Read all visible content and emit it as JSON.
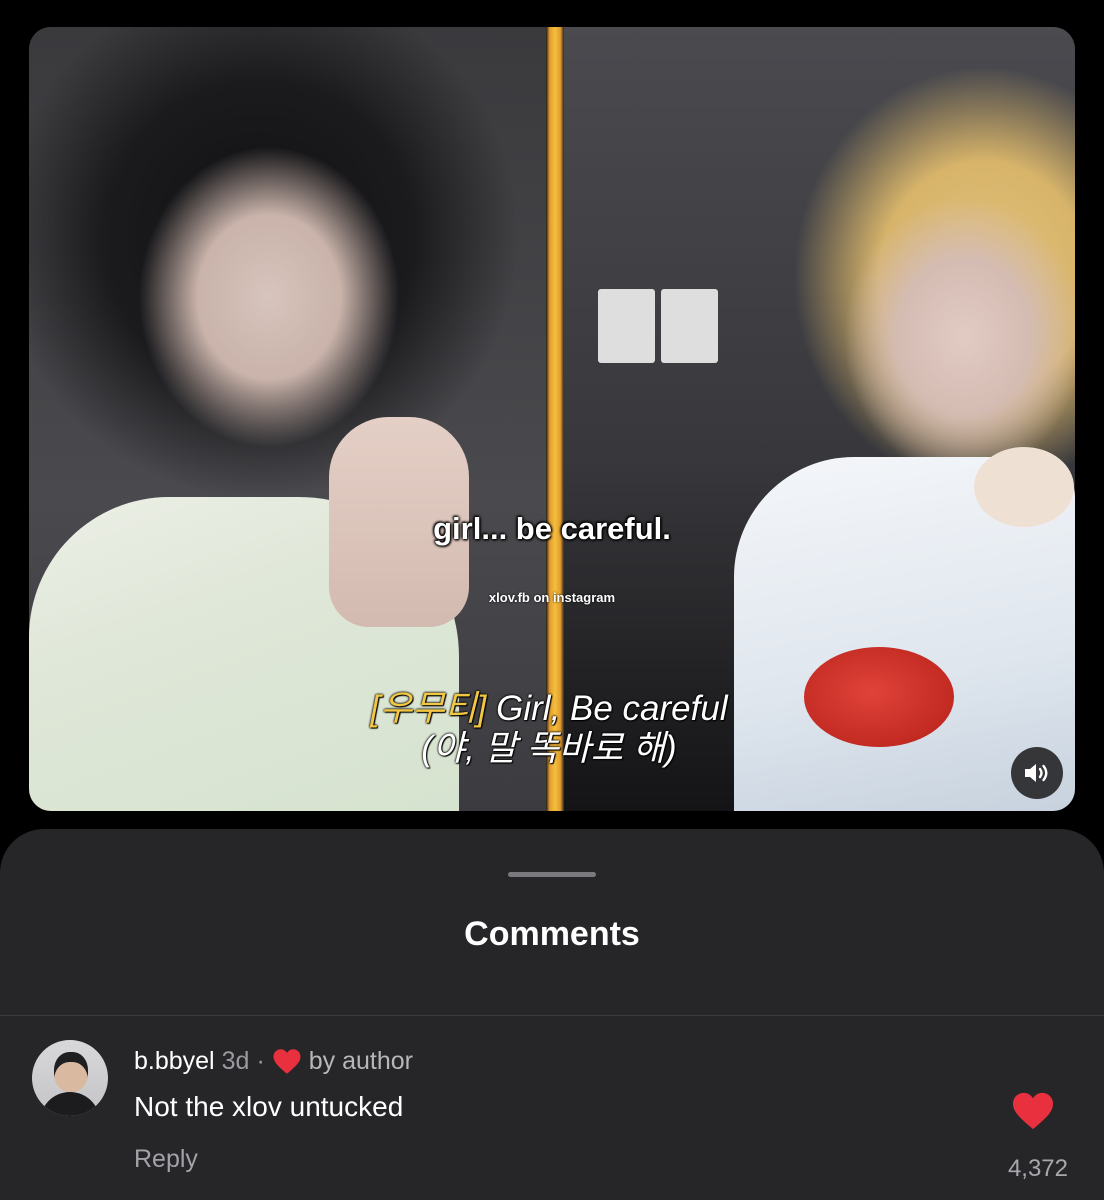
{
  "video": {
    "caption": "girl... be careful.",
    "watermark": "xlov.fb on instagram",
    "subtitle_tag": "[우무티]",
    "subtitle_en": " Girl, Be careful",
    "subtitle_ko": "(야, 말 똑바로 해)",
    "sound_icon": "speaker-volume-icon"
  },
  "sheet": {
    "title": "Comments"
  },
  "comment": {
    "username": "b.bbyel",
    "time": "3d",
    "separator": "·",
    "author_label": "by author",
    "text": "Not the xlov untucked",
    "reply_label": "Reply",
    "like_count": "4,372"
  },
  "colors": {
    "heart": "#e8303f",
    "sheet_bg": "#262628",
    "page_bg": "#000000"
  }
}
